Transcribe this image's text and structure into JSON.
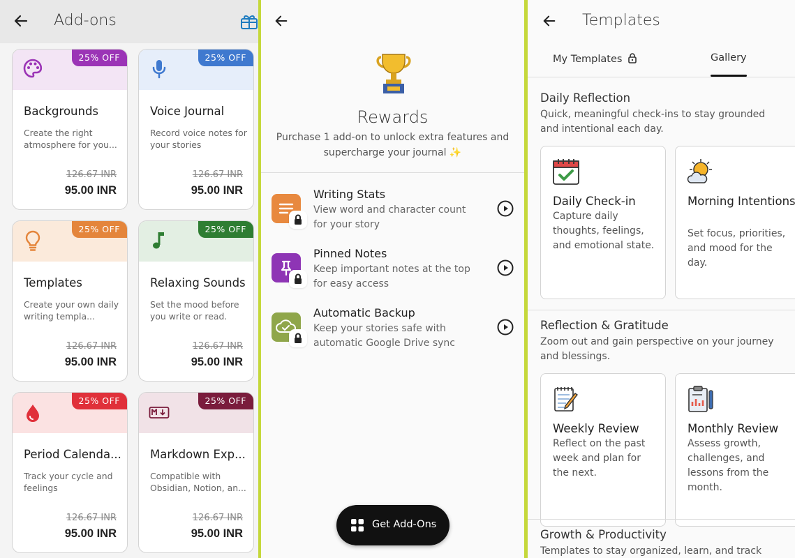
{
  "addons": {
    "title": "Add-ons",
    "cards": [
      {
        "name": "Backgrounds",
        "desc": "Create the right atmosphere for you...",
        "badge": "25% OFF",
        "old_price": "126.67 INR",
        "price": "95.00 INR",
        "icon": "palette-icon",
        "color": "#9b34b6",
        "bg": "#f3e5f5"
      },
      {
        "name": "Voice Journal",
        "desc": "Record voice notes for your stories",
        "badge": "25% OFF",
        "old_price": "126.67 INR",
        "price": "95.00 INR",
        "icon": "microphone-icon",
        "color": "#3f79cf",
        "bg": "#e6eefa"
      },
      {
        "name": "Templates",
        "desc": "Create your own daily writing templa...",
        "badge": "25% OFF",
        "old_price": "126.67 INR",
        "price": "95.00 INR",
        "icon": "lightbulb-icon",
        "color": "#e4853b",
        "bg": "#fbeadb"
      },
      {
        "name": "Relaxing Sounds",
        "desc": "Set the mood before you write or read.",
        "badge": "25% OFF",
        "old_price": "126.67 INR",
        "price": "95.00 INR",
        "icon": "music-note-icon",
        "color": "#2e7d32",
        "bg": "#e3efe3"
      },
      {
        "name": "Period Calenda...",
        "desc": "Track your cycle and feelings",
        "badge": "25% OFF",
        "old_price": "126.67 INR",
        "price": "95.00 INR",
        "icon": "drop-icon",
        "color": "#e0303a",
        "bg": "#fbe2e2"
      },
      {
        "name": "Markdown Exp...",
        "desc": "Compatible with Obsidian, Notion, an...",
        "badge": "25% OFF",
        "old_price": "126.67 INR",
        "price": "95.00 INR",
        "icon": "markdown-icon",
        "color": "#7a1c3c",
        "bg": "#f1e2e7"
      }
    ]
  },
  "rewards": {
    "title": "Rewards",
    "subtitle": "Purchase 1 add-on to unlock extra features and supercharge your journal ✨",
    "items": [
      {
        "name": "Writing Stats",
        "desc": "View word and character count for your story",
        "icon": "writing-stats-icon",
        "color": "#e8893f"
      },
      {
        "name": "Pinned Notes",
        "desc": "Keep important notes at the top for easy access",
        "icon": "pin-icon",
        "color": "#8e35b5"
      },
      {
        "name": "Automatic Backup",
        "desc": "Keep your stories safe with automatic Google Drive sync",
        "icon": "cloud-check-icon",
        "color": "#8fa64a"
      }
    ],
    "button_label": "Get Add-Ons"
  },
  "templates": {
    "title": "Templates",
    "tabs": [
      {
        "label": "My Templates"
      },
      {
        "label": "Gallery"
      }
    ],
    "sections": [
      {
        "title": "Daily Reflection",
        "desc": "Quick, meaningful check-ins to stay grounded and intentional each day.",
        "cards": [
          {
            "name": "Daily Check-in",
            "desc": "Capture daily thoughts, feelings, and emotional state.",
            "icon": "calendar-check-icon"
          },
          {
            "name": "Morning Intentions",
            "desc": "Set focus, priorities, and mood for the day.",
            "icon": "sun-cloud-icon"
          }
        ]
      },
      {
        "title": "Reflection & Gratitude",
        "desc": "Zoom out and gain perspective on your journey and blessings.",
        "cards": [
          {
            "name": "Weekly Review",
            "desc": "Reflect on the past week and plan for the next.",
            "icon": "notepad-pencil-icon"
          },
          {
            "name": "Monthly Review",
            "desc": "Assess growth, challenges, and lessons from the month.",
            "icon": "clipboard-chart-icon"
          }
        ]
      },
      {
        "title": "Growth & Productivity",
        "desc": "Templates to stay organized, learn, and track"
      }
    ]
  }
}
